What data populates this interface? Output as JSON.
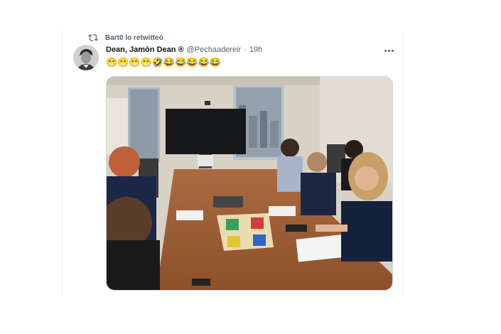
{
  "retweet": {
    "icon": "retweet-icon",
    "text": "Bart0 lo retwitteó"
  },
  "tweet": {
    "author_name": "Dean, Jamón Dean ®",
    "handle": "@Pechaadereir",
    "separator": "·",
    "time": "19h",
    "text": "😁😁😁😁🤣😂😂😂😂😂",
    "more_icon": "more-horizontal-icon",
    "avatar_icon": "avatar",
    "media_description": "Photo of five women seated at a conference table playing a board game"
  },
  "colors": {
    "text_primary": "#0f1419",
    "text_secondary": "#536471",
    "border": "#cfd9de"
  }
}
